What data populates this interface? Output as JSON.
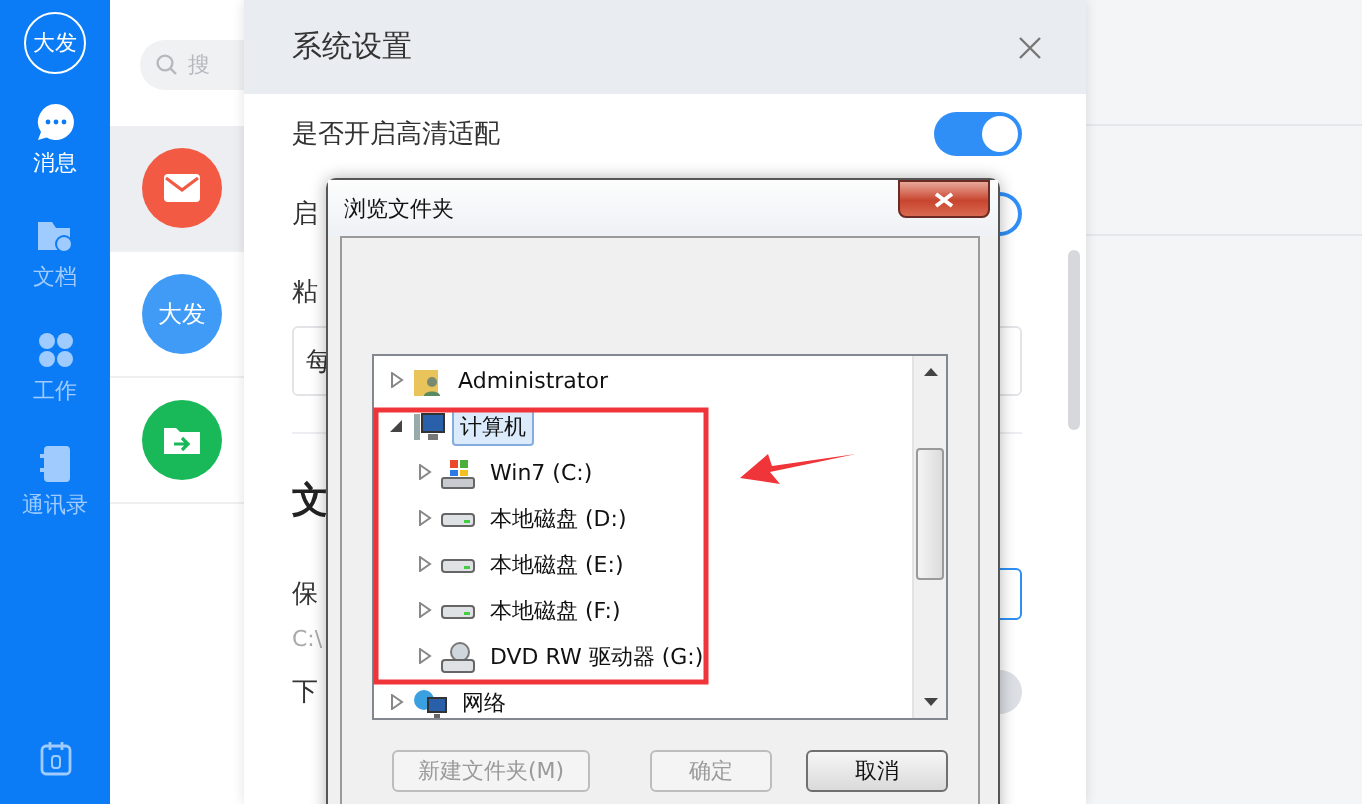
{
  "sidebar": {
    "avatar": "大发",
    "items": [
      {
        "label": "消息",
        "selected": true
      },
      {
        "label": "文档",
        "selected": false
      },
      {
        "label": "工作",
        "selected": false
      },
      {
        "label": "通讯录",
        "selected": false
      }
    ]
  },
  "conversation_list": {
    "search": {
      "placeholder": "搜"
    },
    "items": [
      {
        "kind": "mail",
        "selected": true
      },
      {
        "kind": "avatar",
        "text": "大发",
        "selected": false
      },
      {
        "kind": "folder",
        "selected": false
      }
    ]
  },
  "settings": {
    "title": "系统设置",
    "rows": [
      {
        "kind": "toggle",
        "label": "是否开启高清适配",
        "on": true
      },
      {
        "kind": "toggle",
        "label": "启",
        "on": true
      },
      {
        "kind": "field",
        "label": "粘",
        "value": "每"
      },
      {
        "kind": "heading",
        "label": "文"
      },
      {
        "kind": "path",
        "label": "保",
        "value": "C:\\"
      },
      {
        "kind": "toggle",
        "label": "下",
        "on": false
      }
    ]
  },
  "dialog": {
    "title": "浏览文件夹",
    "tree": [
      {
        "label": "Administrator",
        "kind": "user-folder",
        "expanded": false,
        "selected": false
      },
      {
        "label": "计算机",
        "kind": "computer",
        "expanded": true,
        "selected": true,
        "children": [
          {
            "label": "Win7 (C:)",
            "kind": "system-drive",
            "expanded": false,
            "selected": false
          },
          {
            "label": "本地磁盘 (D:)",
            "kind": "drive",
            "expanded": false,
            "selected": false
          },
          {
            "label": "本地磁盘 (E:)",
            "kind": "drive",
            "expanded": false,
            "selected": false
          },
          {
            "label": "本地磁盘 (F:)",
            "kind": "drive",
            "expanded": false,
            "selected": false
          },
          {
            "label": "DVD RW 驱动器 (G:)",
            "kind": "dvd-drive",
            "expanded": false,
            "selected": false
          }
        ]
      },
      {
        "label": "网络",
        "kind": "network",
        "expanded": false,
        "selected": false
      }
    ],
    "buttons": [
      {
        "label": "新建文件夹(M)",
        "disabled": true
      },
      {
        "label": "确定",
        "disabled": true
      },
      {
        "label": "取消",
        "disabled": false
      }
    ]
  }
}
